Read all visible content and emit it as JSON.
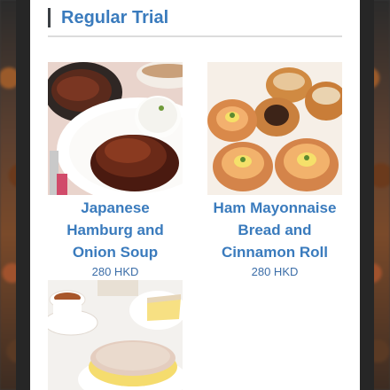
{
  "section": {
    "title": "Regular Trial"
  },
  "items": [
    {
      "name_lines": [
        "Japanese",
        "Hamburg and",
        "Onion Soup"
      ],
      "price": "280 HKD",
      "image_icon": "hamburg-steak-photo"
    },
    {
      "name_lines": [
        "Ham Mayonnaise",
        "Bread and",
        "Cinnamon Roll"
      ],
      "price": "280 HKD",
      "image_icon": "bread-rolls-photo"
    },
    {
      "name_lines": [],
      "price": "",
      "image_icon": "cheesecake-and-tea-photo"
    }
  ],
  "colors": {
    "accent": "#3a7bbd",
    "price": "#3c6ea8",
    "divider": "#dcdcdc"
  }
}
